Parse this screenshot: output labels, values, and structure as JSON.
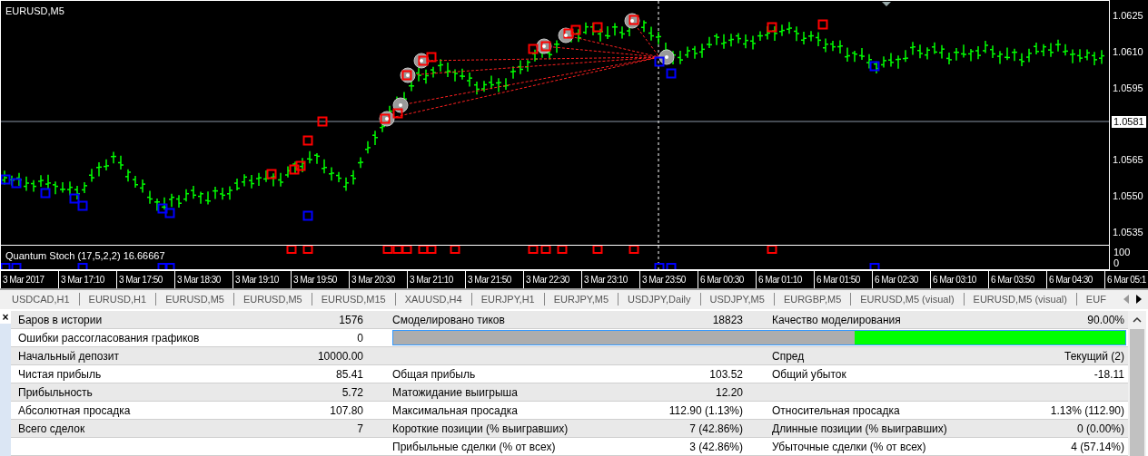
{
  "chart": {
    "symbol": "EURUSD,M5",
    "price_labels": [
      {
        "text": "1.0625",
        "current": false
      },
      {
        "text": "1.0610",
        "current": false
      },
      {
        "text": "1.0595",
        "current": false
      },
      {
        "text": "1.0581",
        "current": true
      },
      {
        "text": "1.0565",
        "current": false
      },
      {
        "text": "1.0550",
        "current": false
      },
      {
        "text": "1.0535",
        "current": false
      }
    ],
    "indicator": {
      "label": "Quantum Stoch (17,5,2,2) 16.66667",
      "axis_labels": [
        "100",
        "0"
      ]
    },
    "time_labels": [
      "3 Mar 2017",
      "3 Mar 17:10",
      "3 Mar 17:50",
      "3 Mar 18:30",
      "3 Mar 19:10",
      "3 Mar 19:50",
      "3 Mar 20:30",
      "3 Mar 21:10",
      "3 Mar 21:50",
      "3 Mar 22:30",
      "3 Mar 23:10",
      "3 Mar 23:50",
      "6 Mar 00:30",
      "6 Mar 01:10",
      "6 Mar 01:50",
      "6 Mar 02:30",
      "6 Mar 03:10",
      "6 Mar 03:50",
      "6 Mar 04:30",
      "6 Mar 05:1"
    ]
  },
  "tabs": [
    {
      "label": "USDCAD,H1"
    },
    {
      "label": "EURUSD,H1"
    },
    {
      "label": "EURUSD,M5"
    },
    {
      "label": "EURUSD,M5"
    },
    {
      "label": "EURUSD,M15"
    },
    {
      "label": "XAUUSD,H4"
    },
    {
      "label": "EURJPY,H1"
    },
    {
      "label": "EURJPY,M5"
    },
    {
      "label": "USDJPY,Daily"
    },
    {
      "label": "USDJPY,M5"
    },
    {
      "label": "EURGBP,M5"
    },
    {
      "label": "EURUSD,M5 (visual)"
    },
    {
      "label": "EURUSD,M5 (visual)"
    },
    {
      "label": "EUF"
    }
  ],
  "report": {
    "close": "×",
    "rows": [
      {
        "cells": [
          {
            "kind": "pair",
            "label": "Баров в истории",
            "value": "1576"
          },
          {
            "kind": "pair",
            "label": "Смоделировано тиков",
            "value": "18823"
          },
          {
            "kind": "pair",
            "label": "Качество моделирования",
            "value": "90.00%"
          }
        ]
      },
      {
        "cells": [
          {
            "kind": "pair",
            "label": "Ошибки рассогласования графиков",
            "value": "0"
          },
          {
            "kind": "quality_bar",
            "level": 0.63
          }
        ]
      },
      {
        "cells": [
          {
            "kind": "pair",
            "label": "Начальный депозит",
            "value": "10000.00"
          },
          {
            "kind": "empty"
          },
          {
            "kind": "pair",
            "label": "Спред",
            "value": "Текущий (2)"
          }
        ]
      },
      {
        "cells": [
          {
            "kind": "pair",
            "label": "Чистая прибыль",
            "value": "85.41"
          },
          {
            "kind": "pair",
            "label": "Общая прибыль",
            "value": "103.52"
          },
          {
            "kind": "pair",
            "label": "Общий убыток",
            "value": "-18.11"
          }
        ]
      },
      {
        "cells": [
          {
            "kind": "pair",
            "label": "Прибыльность",
            "value": "5.72"
          },
          {
            "kind": "pair",
            "label": "Матожидание выигрыша",
            "value": "12.20"
          },
          {
            "kind": "empty"
          }
        ]
      },
      {
        "cells": [
          {
            "kind": "pair",
            "label": "Абсолютная просадка",
            "value": "107.80"
          },
          {
            "kind": "pair",
            "label": "Максимальная просадка",
            "value": "112.90 (1.13%)"
          },
          {
            "kind": "pair",
            "label": "Относительная просадка",
            "value": "1.13% (112.90)"
          }
        ]
      },
      {
        "cells": [
          {
            "kind": "pair",
            "label": "Всего сделок",
            "value": "7"
          },
          {
            "kind": "pair",
            "label": "Короткие позиции (% выигравших)",
            "value": "7 (42.86%)"
          },
          {
            "kind": "pair",
            "label": "Длинные позиции (% выигравших)",
            "value": "0 (0.00%)"
          }
        ]
      },
      {
        "cells": [
          {
            "kind": "empty"
          },
          {
            "kind": "pair",
            "label": "Прибыльные сделки (% от всех)",
            "value": "3 (42.86%)"
          },
          {
            "kind": "pair",
            "label": "Убыточные сделки (% от всех)",
            "value": "4 (57.14%)"
          }
        ]
      }
    ]
  }
}
